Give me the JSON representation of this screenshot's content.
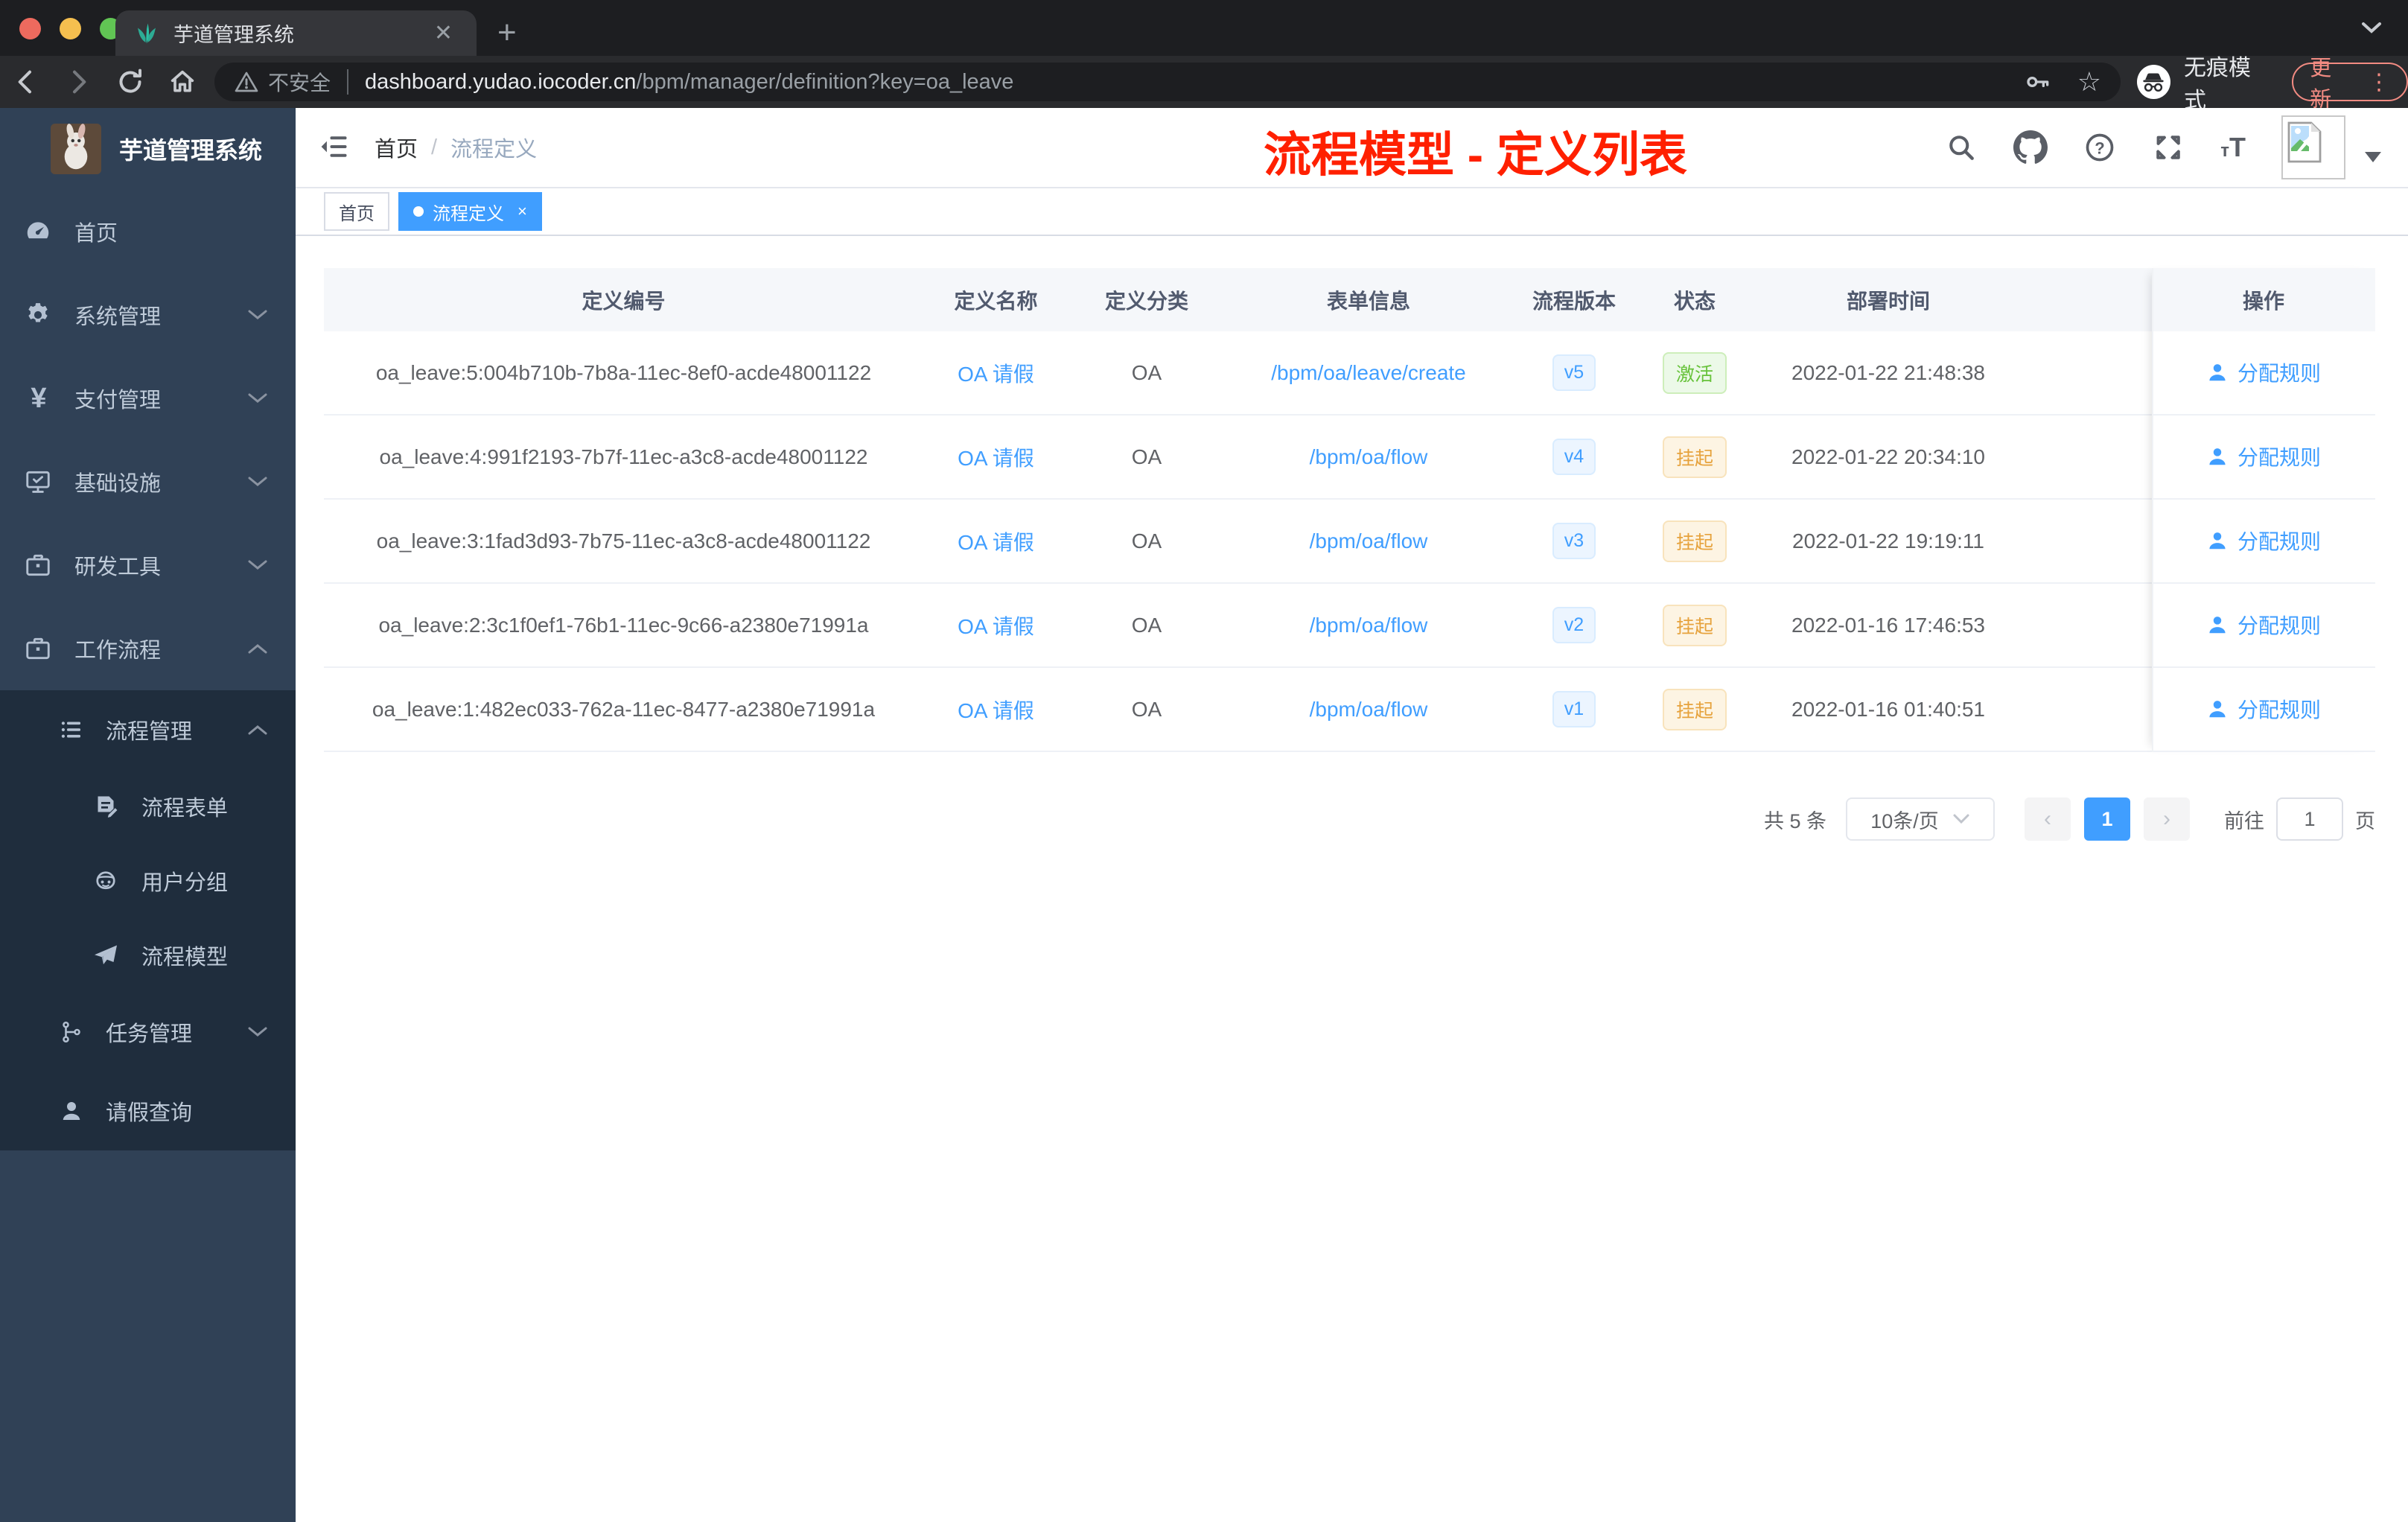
{
  "colors": {
    "accent": "#409eff",
    "success": "#67c23a",
    "warning": "#e6a23c",
    "annotation": "#ff2000"
  },
  "browser": {
    "tab_title": "芋道管理系统",
    "security_label": "不安全",
    "url_host": "dashboard.yudao.iocoder.cn",
    "url_path": "/bpm/manager/definition?key=oa_leave",
    "incognito_label": "无痕模式",
    "update_label": "更新"
  },
  "sidebar": {
    "logo_title": "芋道管理系统",
    "items": [
      {
        "label": "首页",
        "icon": "dashboard-icon"
      },
      {
        "label": "系统管理",
        "icon": "gear-icon"
      },
      {
        "label": "支付管理",
        "icon": "yen-icon"
      },
      {
        "label": "基础设施",
        "icon": "monitor-icon"
      },
      {
        "label": "研发工具",
        "icon": "briefcase-icon"
      },
      {
        "label": "工作流程",
        "icon": "briefcase-icon"
      }
    ],
    "submenu": [
      {
        "label": "流程管理",
        "icon": "list-icon",
        "children": [
          {
            "label": "流程表单",
            "icon": "form-icon"
          },
          {
            "label": "用户分组",
            "icon": "robot-icon"
          },
          {
            "label": "流程模型",
            "icon": "send-icon"
          }
        ]
      },
      {
        "label": "任务管理",
        "icon": "tree-icon"
      },
      {
        "label": "请假查询",
        "icon": "person-icon"
      }
    ]
  },
  "navbar": {
    "breadcrumb": {
      "home": "首页",
      "separator": "/",
      "current": "流程定义"
    },
    "annotation": "流程模型 - 定义列表"
  },
  "tags": {
    "home": "首页",
    "active": "流程定义",
    "close": "×"
  },
  "table": {
    "columns": [
      "定义编号",
      "定义名称",
      "定义分类",
      "表单信息",
      "流程版本",
      "状态",
      "部署时间",
      "操作"
    ],
    "rows": [
      {
        "id": "oa_leave:5:004b710b-7b8a-11ec-8ef0-acde48001122",
        "name": "OA 请假",
        "category": "OA",
        "form": "/bpm/oa/leave/create",
        "version": "v5",
        "status": "激活",
        "status_type": "success",
        "deploy_time": "2022-01-22 21:48:38",
        "action": "分配规则"
      },
      {
        "id": "oa_leave:4:991f2193-7b7f-11ec-a3c8-acde48001122",
        "name": "OA 请假",
        "category": "OA",
        "form": "/bpm/oa/flow",
        "version": "v4",
        "status": "挂起",
        "status_type": "warning",
        "deploy_time": "2022-01-22 20:34:10",
        "action": "分配规则"
      },
      {
        "id": "oa_leave:3:1fad3d93-7b75-11ec-a3c8-acde48001122",
        "name": "OA 请假",
        "category": "OA",
        "form": "/bpm/oa/flow",
        "version": "v3",
        "status": "挂起",
        "status_type": "warning",
        "deploy_time": "2022-01-22 19:19:11",
        "action": "分配规则"
      },
      {
        "id": "oa_leave:2:3c1f0ef1-76b1-11ec-9c66-a2380e71991a",
        "name": "OA 请假",
        "category": "OA",
        "form": "/bpm/oa/flow",
        "version": "v2",
        "status": "挂起",
        "status_type": "warning",
        "deploy_time": "2022-01-16 17:46:53",
        "action": "分配规则"
      },
      {
        "id": "oa_leave:1:482ec033-762a-11ec-8477-a2380e71991a",
        "name": "OA 请假",
        "category": "OA",
        "form": "/bpm/oa/flow",
        "version": "v1",
        "status": "挂起",
        "status_type": "warning",
        "deploy_time": "2022-01-16 01:40:51",
        "action": "分配规则"
      }
    ]
  },
  "pagination": {
    "total": "共 5 条",
    "page_size": "10条/页",
    "prev": "‹",
    "current": "1",
    "next": "›",
    "goto": "前往",
    "input_value": "1",
    "unit": "页"
  }
}
